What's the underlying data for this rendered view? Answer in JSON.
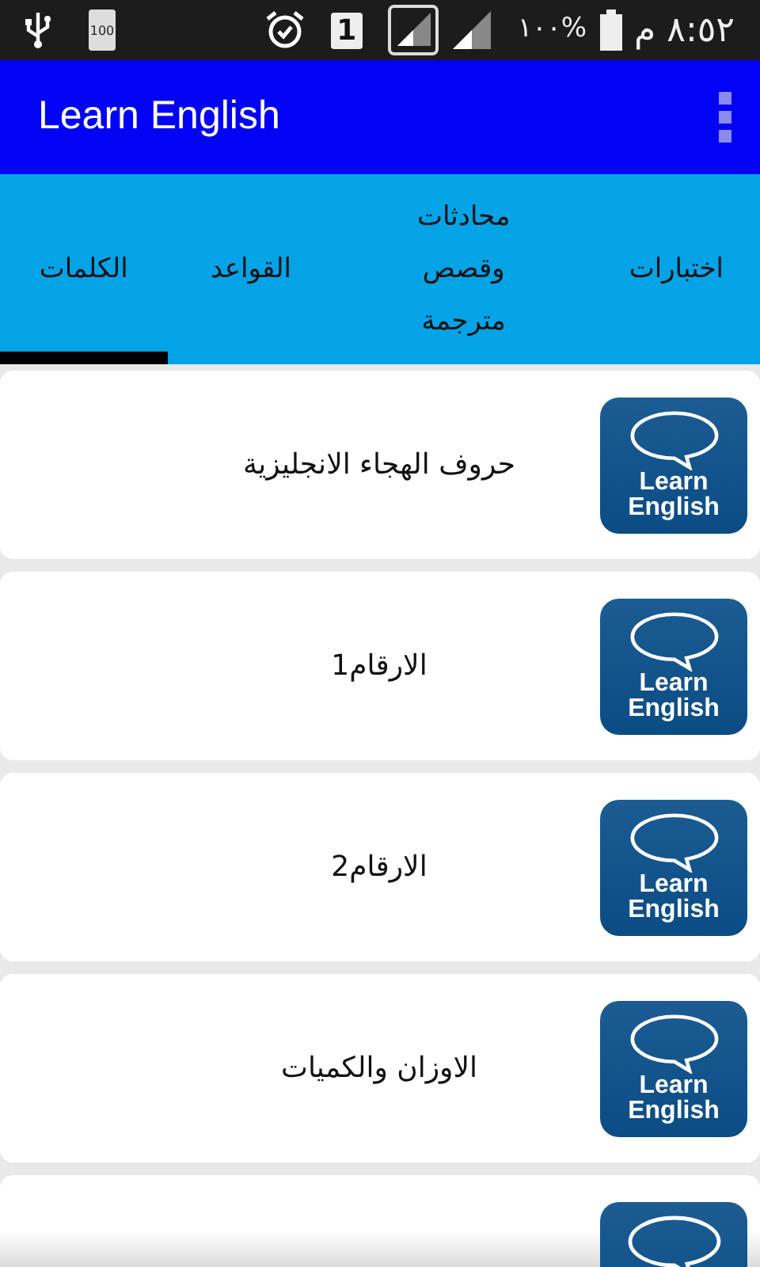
{
  "status_bar": {
    "battery_small": "100",
    "sim": "1",
    "battery_percent": "١٠٠%",
    "time": "٨:٥٢ م"
  },
  "app_bar": {
    "title": "Learn English"
  },
  "tabs": [
    {
      "label": "اختبارات",
      "selected": false
    },
    {
      "label": "محادثات وقصص مترجمة",
      "selected": false
    },
    {
      "label": "القواعد",
      "selected": false
    },
    {
      "label": "الكلمات",
      "selected": true
    }
  ],
  "items": [
    {
      "title": "حروف الهجاء الانجليزية",
      "logo_line_1": "Learn",
      "logo_line_2": "English"
    },
    {
      "title": "الارقام1",
      "logo_line_1": "Learn",
      "logo_line_2": "English"
    },
    {
      "title": "الارقام2",
      "logo_line_1": "Learn",
      "logo_line_2": "English"
    },
    {
      "title": "الاوزان والكميات",
      "logo_line_1": "Learn",
      "logo_line_2": "English"
    },
    {
      "kind": "partial"
    }
  ]
}
